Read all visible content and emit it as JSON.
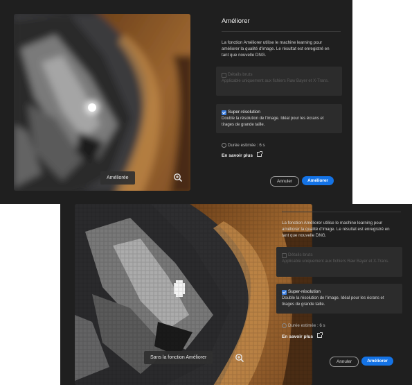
{
  "dialog_top": {
    "preview_label": "Améliorée",
    "title": "Améliorer",
    "description": "La fonction Améliorer utilise le machine learning pour améliorer la qualité d'image. Le résultat est enregistré en tant que nouvelle DNG.",
    "raw_details": {
      "label": "Détails bruts",
      "note": "Applicable uniquement aux fichiers Raw Bayer et X-Trans.",
      "checked": false,
      "enabled": false
    },
    "super_resolution": {
      "label": "Super-résolution",
      "note": "Double la résolution de l'image. Idéal pour les écrans et tirages de grande taille.",
      "checked": true
    },
    "estimated_duration": "Durée estimée : 6 s",
    "learn_more": "En savoir plus",
    "cancel_label": "Annuler",
    "enhance_label": "Améliorer"
  },
  "dialog_bottom": {
    "preview_label": "Sans la fonction Améliorer",
    "description": "La fonction Améliorer utilise le machine learning pour améliorer la qualité d'image. Le résultat est enregistré en tant que nouvelle DNG.",
    "raw_details": {
      "label": "Détails bruts",
      "note": "Applicable uniquement aux fichiers Raw Bayer et X-Trans.",
      "checked": false,
      "enabled": false
    },
    "super_resolution": {
      "label": "Super-résolution",
      "note": "Double la résolution de l'image. Idéal pour les écrans et tirages de grande taille.",
      "checked": true
    },
    "estimated_duration": "Durée estimée : 6 s",
    "learn_more": "En savoir plus",
    "cancel_label": "Annuler",
    "enhance_label": "Améliorer"
  },
  "colors": {
    "dialog_bg": "#1f1f1f",
    "card_bg": "#2c2c2c",
    "accent_blue": "#1473e6"
  },
  "icons": [
    "zoom-in-icon",
    "clock-icon",
    "external-link-icon",
    "checkbox-icon"
  ]
}
